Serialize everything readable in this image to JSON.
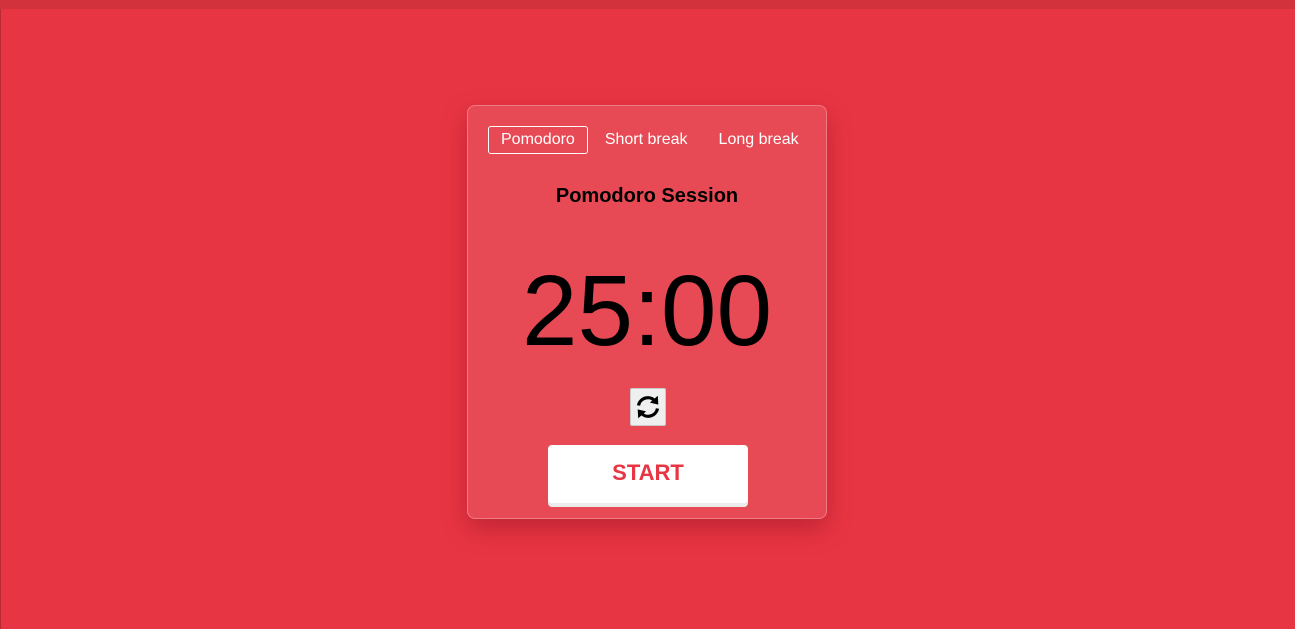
{
  "colors": {
    "background": "#e83543",
    "card": "#e84a55",
    "accent": "#e83543",
    "progress_track": "#d1323b"
  },
  "progress": {
    "fraction": 0
  },
  "tabs": [
    {
      "label": "Pomodoro",
      "active": true
    },
    {
      "label": "Short break",
      "active": false
    },
    {
      "label": "Long break",
      "active": false
    }
  ],
  "session": {
    "title": "Pomodoro Session"
  },
  "timer": {
    "display": "25:00"
  },
  "controls": {
    "reset_icon": "refresh-icon",
    "start_label": "START"
  }
}
